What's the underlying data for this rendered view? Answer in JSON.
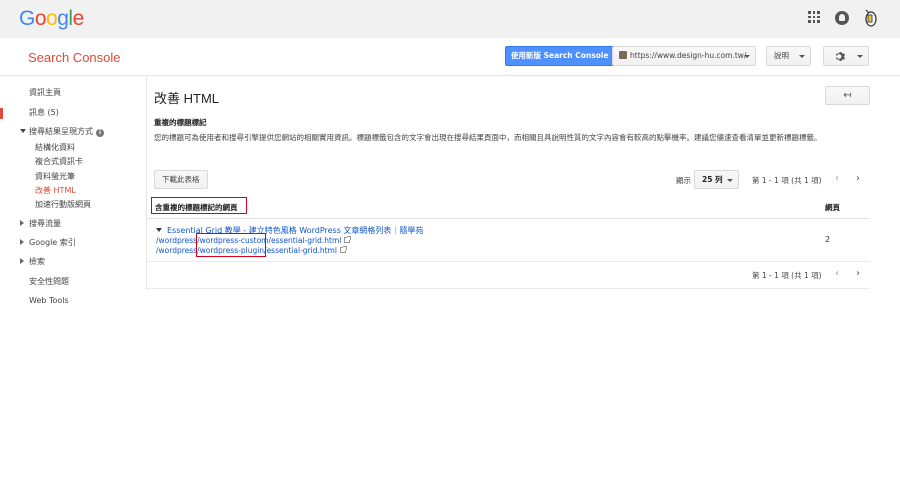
{
  "app": {
    "logo_letters": [
      {
        "ch": "G",
        "color": "#4285f4"
      },
      {
        "ch": "o",
        "color": "#ea4335"
      },
      {
        "ch": "o",
        "color": "#fbbc05"
      },
      {
        "ch": "g",
        "color": "#4285f4"
      },
      {
        "ch": "l",
        "color": "#34a853"
      },
      {
        "ch": "e",
        "color": "#ea4335"
      }
    ],
    "product_name": "Search Console"
  },
  "topbar": {
    "icons": [
      "apps-grid-icon",
      "notifications-icon",
      "account-avatar-icon"
    ]
  },
  "header": {
    "new_version_button": "使用新版 Search Console",
    "site_selector": "https://www.design-hu.com.tw/",
    "help_button": "說明",
    "settings_icon": "gear-icon"
  },
  "sidebar": {
    "items": [
      {
        "label": "資訊主頁"
      },
      {
        "label": "訊息 (5)"
      },
      {
        "label": "搜尋結果呈現方式"
      },
      {
        "label": "結構化資料"
      },
      {
        "label": "複合式資訊卡"
      },
      {
        "label": "資料螢光筆"
      },
      {
        "label": "改善 HTML"
      },
      {
        "label": "加速行動版網頁"
      },
      {
        "label": "搜尋流量"
      },
      {
        "label": "Google 索引"
      },
      {
        "label": "檢索"
      },
      {
        "label": "安全性問題"
      },
      {
        "label": "Web Tools"
      }
    ],
    "info_badge": "i",
    "active_index": 6
  },
  "main": {
    "title": "改善 HTML",
    "back_icon": "↤",
    "section_title": "重複的標題標記",
    "description": "您的標題可為使用者和搜尋引擎提供您網站的相關實用資訊。標題標籤包含的文字會出現在搜尋結果頁面中，而相關且具說明性質的文字內容會有較高的點擊機率。建議您儘速查看清單並更新標題標籤。",
    "download_button": "下載此表格",
    "show_label": "顯示",
    "rows_per_page": "25 列",
    "pager_text": "第 1 - 1 項 (共 1 項)",
    "table": {
      "headers": [
        "含重複的標題標記的網頁",
        "網頁"
      ],
      "rows": [
        {
          "title": "Essential Grid 教學 - 建立特色風格 WordPress 文章網格列表｜隨學苑",
          "urls": [
            "/wordpress/wordpress-custom/essential-grid.html",
            "/wordpress/wordpress-plugin/essential-grid.html"
          ],
          "pages": "2"
        }
      ]
    },
    "highlight_color": "#d0021b"
  }
}
